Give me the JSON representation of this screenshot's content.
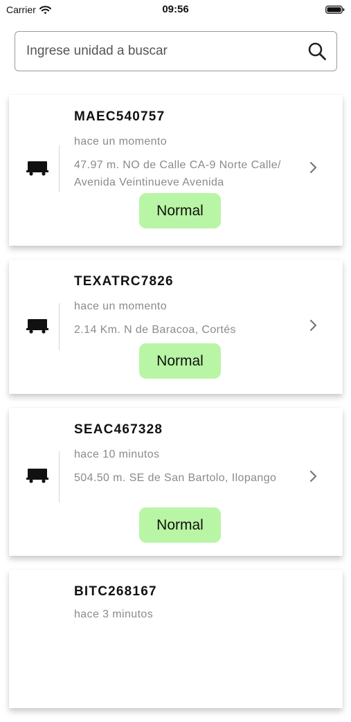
{
  "status_bar": {
    "carrier": "Carrier",
    "time": "09:56"
  },
  "search": {
    "placeholder": "Ingrese unidad a buscar"
  },
  "icons": {
    "wifi": "wifi-icon",
    "battery": "battery-icon",
    "search": "search-icon",
    "truck": "truck-icon",
    "chevron": "chevron-right-icon"
  },
  "colors": {
    "status_normal_bg": "#b8f5a4",
    "muted_text": "#8a8a8a"
  },
  "units": [
    {
      "name": "MAEC540757",
      "time": "hace un momento",
      "address": "47.97 m. NO de  Calle CA-9 Norte Calle/ Avenida Veintinueve Avenida",
      "status": "Normal"
    },
    {
      "name": "TEXATRC7826",
      "time": "hace un momento",
      "address": "2.14 Km. N de Baracoa, Cortés",
      "status": "Normal"
    },
    {
      "name": "SEAC467328",
      "time": "hace 10 minutos",
      "address": "504.50 m. SE de San Bartolo, Ilopango",
      "status": "Normal"
    },
    {
      "name": "BITC268167",
      "time": "hace 3 minutos",
      "address": "",
      "status": ""
    }
  ]
}
